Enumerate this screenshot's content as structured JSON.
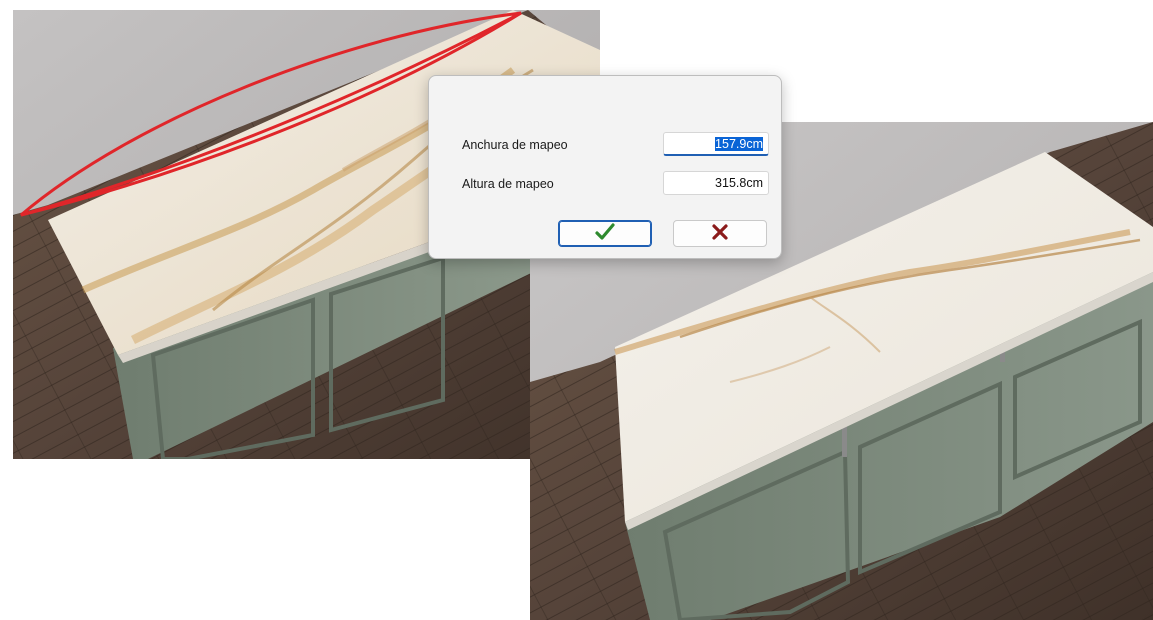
{
  "dialog": {
    "width_label": "Anchura de mapeo",
    "width_value": "157.9cm",
    "height_label": "Altura de mapeo",
    "height_value": "315.8cm",
    "ok_icon": "check-icon",
    "cancel_icon": "close-icon"
  },
  "colors": {
    "annotation": "#e0262a",
    "confirm": "#2e8a2e",
    "cancel": "#8b1a1a",
    "cabinet": "#7d8b7c",
    "marble": "#efe9df",
    "floor": "#5b4a3c",
    "wall": "#bdbdbd",
    "selection": "#0a64d6"
  },
  "scenes": {
    "left": "render-before-remap",
    "right": "render-after-remap"
  }
}
